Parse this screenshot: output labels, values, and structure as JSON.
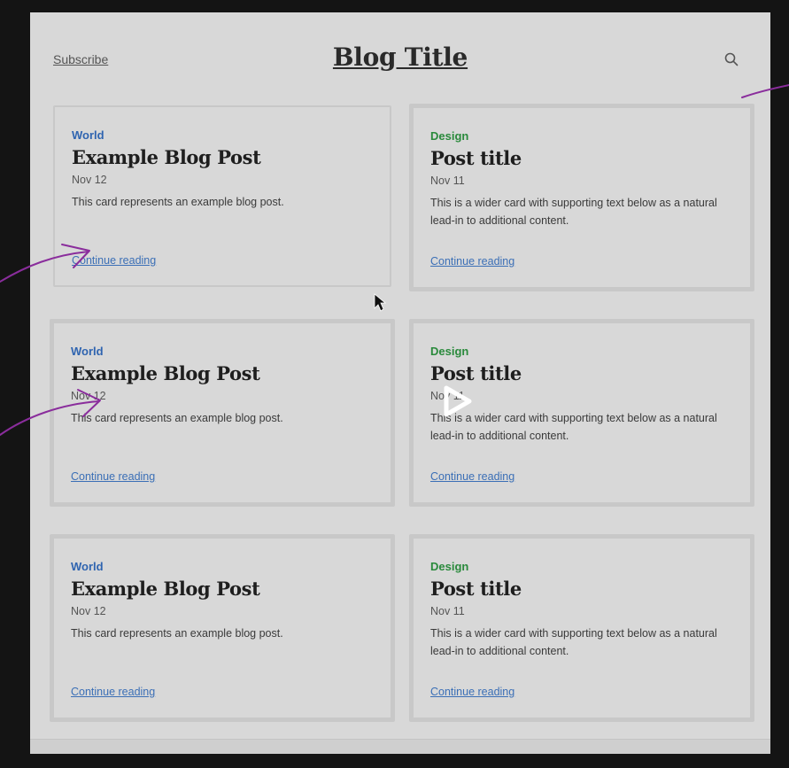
{
  "header": {
    "subscribe_label": "Subscribe",
    "title": "Blog Title",
    "search_icon": "search-icon"
  },
  "cards": [
    {
      "category": "World",
      "title": "Example Blog Post",
      "date": "Nov 12",
      "excerpt": "This card represents an example blog post.",
      "link": "Continue reading"
    },
    {
      "category": "Design",
      "title": "Post title",
      "date": "Nov 11",
      "excerpt": "This is a wider card with supporting text below as a natural lead-in to additional content.",
      "link": "Continue reading"
    },
    {
      "category": "World",
      "title": "Example Blog Post",
      "date": "Nov 12",
      "excerpt": "This card represents an example blog post.",
      "link": "Continue reading"
    },
    {
      "category": "Design",
      "title": "Post title",
      "date": "Nov 11",
      "excerpt": "This is a wider card with supporting text below as a natural lead-in to additional content.",
      "link": "Continue reading"
    },
    {
      "category": "World",
      "title": "Example Blog Post",
      "date": "Nov 12",
      "excerpt": "This card represents an example blog post.",
      "link": "Continue reading"
    },
    {
      "category": "Design",
      "title": "Post title",
      "date": "Nov 11",
      "excerpt": "This is a wider card with supporting text below as a natural lead-in to additional content.",
      "link": "Continue reading"
    }
  ],
  "colors": {
    "world": "#2f64b0",
    "design": "#2a8a3c",
    "link": "#3b6fb6",
    "annotation": "#8a2d9c"
  },
  "overlay": {
    "play_icon": "play-icon",
    "cursor_icon": "mouse-cursor-icon"
  }
}
